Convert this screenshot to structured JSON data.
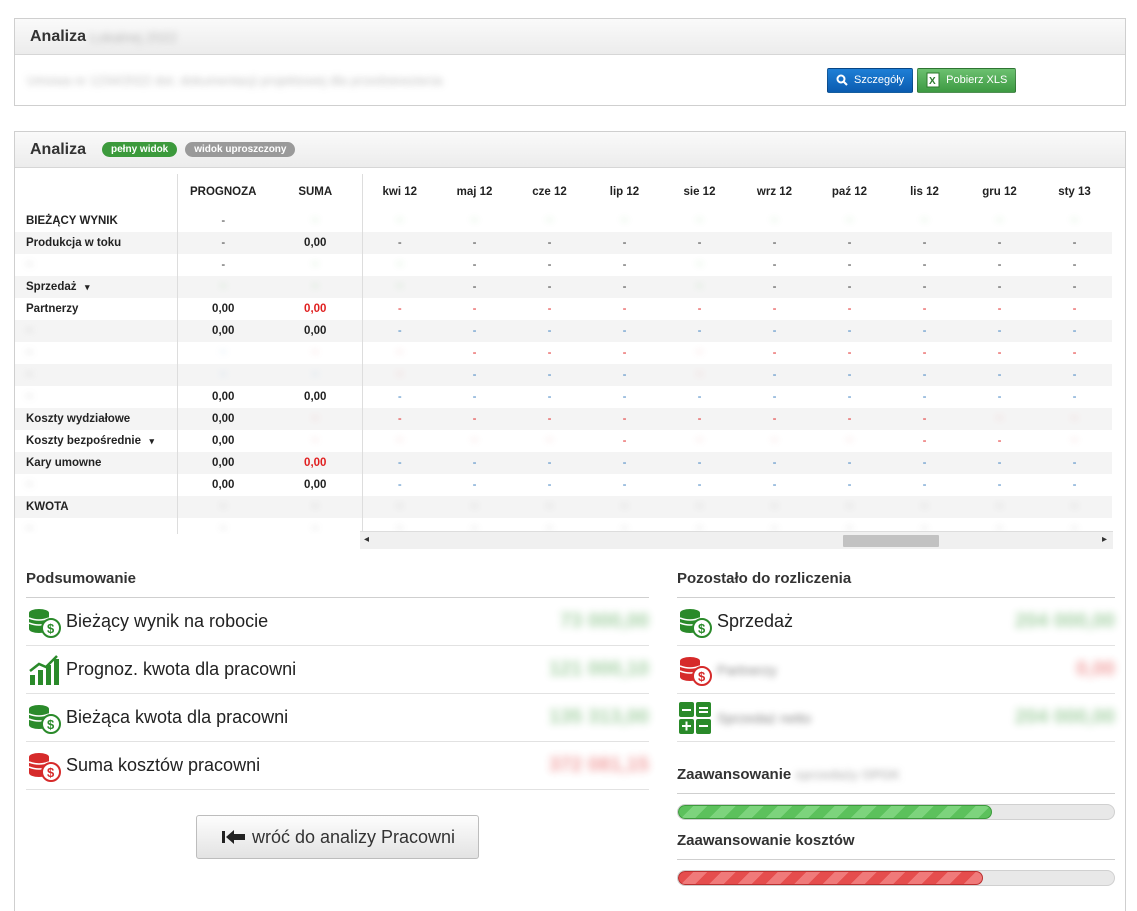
{
  "top_panel": {
    "title": "Analiza",
    "title_suffix_blurred": "Lokalnej 2022",
    "description_blurred": "Umowa nr 1234/2022 dot. dokumentacji projektowej dla przedsiewziecia",
    "details_button": "Szczegóły",
    "xls_button": "Pobierz XLS"
  },
  "analysis_panel": {
    "title": "Analiza",
    "full_view_pill": "pełny widok",
    "simple_view_pill": "widok uproszczony",
    "columns": [
      "PROGNOZA",
      "SUMA",
      "kwi 12",
      "maj 12",
      "cze 12",
      "lip 12",
      "sie 12",
      "wrz 12",
      "paź 12",
      "lis 12",
      "gru 12",
      "sty 13"
    ],
    "rows": [
      {
        "label": "BIEŻĄCY WYNIK",
        "cells": [
          "-",
          "~",
          "~",
          "~",
          "~",
          "~",
          "~",
          "~",
          "~",
          "~",
          "~",
          "~"
        ]
      },
      {
        "label": "Produkcja w toku",
        "cells": [
          "-",
          "0,00",
          "-",
          "-",
          "-",
          "-",
          "-",
          "-",
          "-",
          "-",
          "-",
          "-"
        ]
      },
      {
        "label": "~",
        "cells": [
          "-",
          "~",
          "~",
          "-",
          "-",
          "-",
          "~",
          "-",
          "-",
          "-",
          "-",
          "-"
        ]
      },
      {
        "label": "Sprzedaż",
        "dropdown": true,
        "cells": [
          "~",
          "~",
          "~",
          "-",
          "-",
          "-",
          "~",
          "-",
          "-",
          "-",
          "-",
          "-"
        ]
      },
      {
        "label": "Partnerzy",
        "cells": [
          "0,00",
          "0,00",
          "-",
          "-",
          "-",
          "-",
          "-",
          "-",
          "-",
          "-",
          "-",
          "-"
        ]
      },
      {
        "label": "~",
        "cells": [
          "0,00",
          "0,00",
          "-",
          "-",
          "-",
          "-",
          "-",
          "-",
          "-",
          "-",
          "-",
          "-"
        ]
      },
      {
        "label": "~",
        "cells": [
          "~",
          "~",
          "~",
          "-",
          "-",
          "-",
          "~",
          "-",
          "-",
          "-",
          "-",
          "-"
        ]
      },
      {
        "label": "~",
        "cells": [
          "~",
          "~",
          "~",
          "-",
          "-",
          "-",
          "~",
          "-",
          "-",
          "-",
          "-",
          "-"
        ]
      },
      {
        "label": "~",
        "cells": [
          "0,00",
          "0,00",
          "-",
          "-",
          "-",
          "-",
          "-",
          "-",
          "-",
          "-",
          "-",
          "-"
        ]
      },
      {
        "label": "Koszty wydziałowe",
        "cells": [
          "0,00",
          "~",
          "-",
          "-",
          "-",
          "-",
          "-",
          "-",
          "-",
          "-",
          "~",
          "~"
        ]
      },
      {
        "label": "Koszty bezpośrednie",
        "dropdown": true,
        "cells": [
          "0,00",
          "~",
          "~",
          "~",
          "~",
          "-",
          "~",
          "~",
          "~",
          "-",
          "-",
          "~"
        ]
      },
      {
        "label": "Kary umowne",
        "cells": [
          "0,00",
          "0,00",
          "-",
          "-",
          "-",
          "-",
          "-",
          "-",
          "-",
          "-",
          "-",
          "-"
        ]
      },
      {
        "label": "~",
        "cells": [
          "0,00",
          "0,00",
          "-",
          "-",
          "-",
          "-",
          "-",
          "-",
          "-",
          "-",
          "-",
          "-"
        ]
      },
      {
        "label": "KWOTA",
        "cells": [
          "~",
          "~",
          "~",
          "~",
          "~",
          "~",
          "~",
          "~",
          "~",
          "~",
          "~",
          "~"
        ]
      },
      {
        "label": "~",
        "cells": [
          "~",
          "~",
          "~",
          "~",
          "~",
          "~",
          "~",
          "~",
          "~",
          "~",
          "~",
          "~"
        ]
      }
    ]
  },
  "summary": {
    "title": "Podsumowanie",
    "items": [
      {
        "label": "Bieżący wynik na robocie",
        "icon": "coins-green-icon",
        "value": "73 000,00",
        "color": "#3a9a3a"
      },
      {
        "label": "Prognoz. kwota dla pracowni",
        "icon": "growth-chart-icon",
        "value": "121 000,10",
        "color": "#3a9a3a"
      },
      {
        "label": "Bieżąca kwota dla pracowni",
        "icon": "coins-green-icon",
        "value": "135 313,00",
        "color": "#3a9a3a"
      },
      {
        "label": "Suma kosztów pracowni",
        "icon": "coins-red-icon",
        "value": "372 081,15",
        "color": "#e03030"
      }
    ]
  },
  "remaining": {
    "title": "Pozostało do rozliczenia",
    "items": [
      {
        "label": "Sprzedaż",
        "icon": "coins-green-icon",
        "value": "204 000,00",
        "color": "#3a9a3a"
      },
      {
        "label": "Partnerzy",
        "icon": "coins-red-icon",
        "value": "0,00",
        "color": "#e03030"
      },
      {
        "label": "Sprzedaż netto",
        "icon": "calculator-icon",
        "value": "204 000,00",
        "color": "#3a9a3a"
      }
    ]
  },
  "progress_sales": {
    "title": "Zaawansowanie",
    "title_blurred": "sprzedaży OPGK",
    "percent": 72
  },
  "progress_costs": {
    "title": "Zaawansowanie kosztów",
    "percent": 70
  },
  "back_button": "wróć do analizy Pracowni"
}
